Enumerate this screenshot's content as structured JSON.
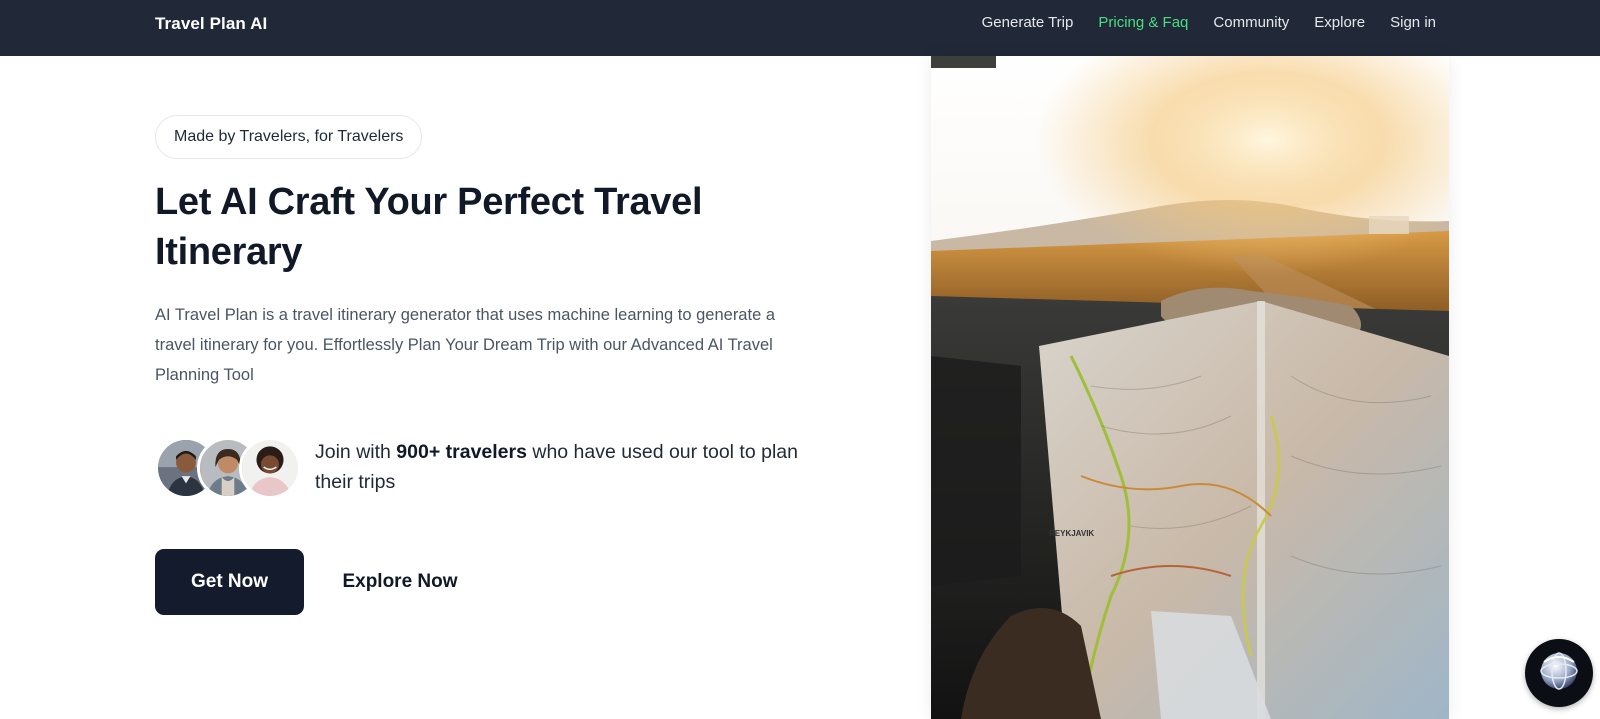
{
  "nav": {
    "brand": "Travel Plan AI",
    "links": [
      {
        "label": "Generate Trip"
      },
      {
        "label": "Pricing & Faq",
        "active": true
      },
      {
        "label": "Community"
      },
      {
        "label": "Explore"
      },
      {
        "label": "Sign in"
      }
    ]
  },
  "hero": {
    "badge": "Made by Travelers, for Travelers",
    "headline": "Let AI Craft Your Perfect Travel Itinerary",
    "description": "AI Travel Plan is a travel itinerary generator that uses machine learning to generate a travel itinerary for you. Effortlessly Plan Your Dream Trip with our Advanced AI Travel Planning Tool",
    "social_prefix": "Join with ",
    "social_count": "900+ travelers",
    "social_suffix": " who have used our tool to plan their trips",
    "primary_button": "Get Now",
    "secondary_button": "Explore Now",
    "map_label": "REYKJAVIK"
  },
  "colors": {
    "nav_bg": "#212938",
    "accent_green": "#4ade80",
    "button_dark": "#141b2d"
  },
  "icons": {
    "chat_widget": "globe-icon"
  }
}
